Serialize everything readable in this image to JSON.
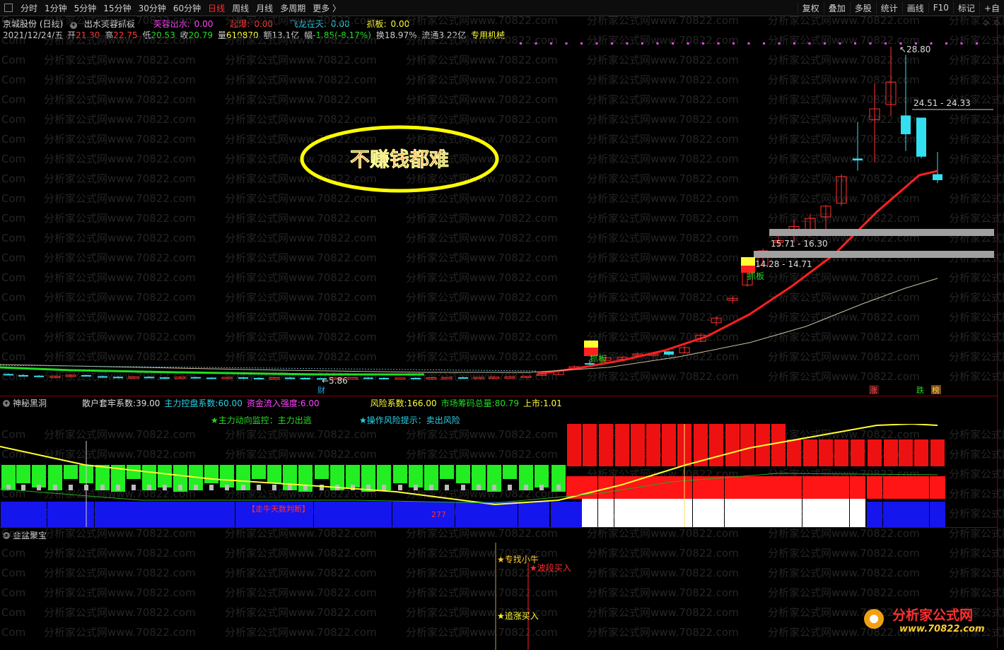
{
  "toolbar": {
    "periods": [
      "分时",
      "1分钟",
      "5分钟",
      "15分钟",
      "30分钟",
      "60分钟",
      "日线",
      "周线",
      "月线",
      "多周期",
      "更多 〉"
    ],
    "active_period": "日线",
    "right_buttons": [
      "复权",
      "叠加",
      "多股",
      "统计",
      "画线",
      "F10",
      "标记",
      "+自"
    ]
  },
  "header": {
    "stock": "京城股份 (日线)",
    "indicator": "出水芙蓉抓板",
    "params": [
      {
        "label": "芙蓉出水:",
        "value": "0.00",
        "color": "#ff44ff"
      },
      {
        "label": "起爆:",
        "value": "0.00",
        "color": "#ff3b3b"
      },
      {
        "label": "飞龙在天:",
        "value": "0.00",
        "color": "#27d3e8"
      },
      {
        "label": "抓板:",
        "value": "0.00",
        "color": "#ffff33"
      }
    ],
    "quote": {
      "date": "2021/12/24/五",
      "open_label": "开",
      "open": "21.30",
      "high_label": "高",
      "high": "22.75",
      "low_label": "低",
      "low": "20.53",
      "close_label": "收",
      "close": "20.79",
      "vol_label": "量",
      "vol": "610870",
      "amt_label": "额",
      "amt": "13.1亿",
      "chg_label": "幅",
      "chg": "-1.85(-8.17%)",
      "turn_label": "换",
      "turn": "18.97%",
      "float_label": "流通",
      "float": "3.22亿",
      "industry": "专用机械"
    }
  },
  "main_chart": {
    "callout": "不赚钱都难",
    "max_price": "28.80",
    "min_price": "5.86",
    "zones": [
      "24.51 - 24.33",
      "15.71 - 16.30",
      "14.28 - 14.71"
    ],
    "grab_labels": [
      "抓板",
      "抓板"
    ],
    "markers": [
      "财",
      "涨",
      "跌",
      "榜"
    ],
    "colors": {
      "up": "#ff3030",
      "down": "#33e0f0",
      "ma": "#ff2020",
      "green_line": "#22dd22"
    }
  },
  "panel1": {
    "title": "神秘黑洞",
    "params": [
      {
        "label": "散户套牢系数:",
        "value": "39.00",
        "color": "#dddddd"
      },
      {
        "label": "主力控盘系数:",
        "value": "60.00",
        "color": "#27d3e8"
      },
      {
        "label": "资金流入强度:",
        "value": "6.00",
        "color": "#ff44ff"
      },
      {
        "label": "风险系数:",
        "value": "166.00",
        "color": "#ffff33"
      },
      {
        "label": "市场筹码总量:",
        "value": "80.79",
        "color": "#22dd22"
      },
      {
        "label": "上市:",
        "value": "1.01",
        "color": "#ffff33"
      }
    ],
    "signal1": "★主力动向监控：主力出逃",
    "signal2": "★操作风险提示：卖出风险",
    "note": "走牛天数判断",
    "note_value": "277"
  },
  "panel2": {
    "title": "金盆聚宝",
    "labels": [
      "★专找小牛",
      "★波段买入",
      "★追涨买入"
    ]
  },
  "watermark": {
    "items": [
      "Com",
      "分析家公式网www.70822.com"
    ],
    "logo": "分析家公式网",
    "logo_url": "www.70822.com"
  }
}
